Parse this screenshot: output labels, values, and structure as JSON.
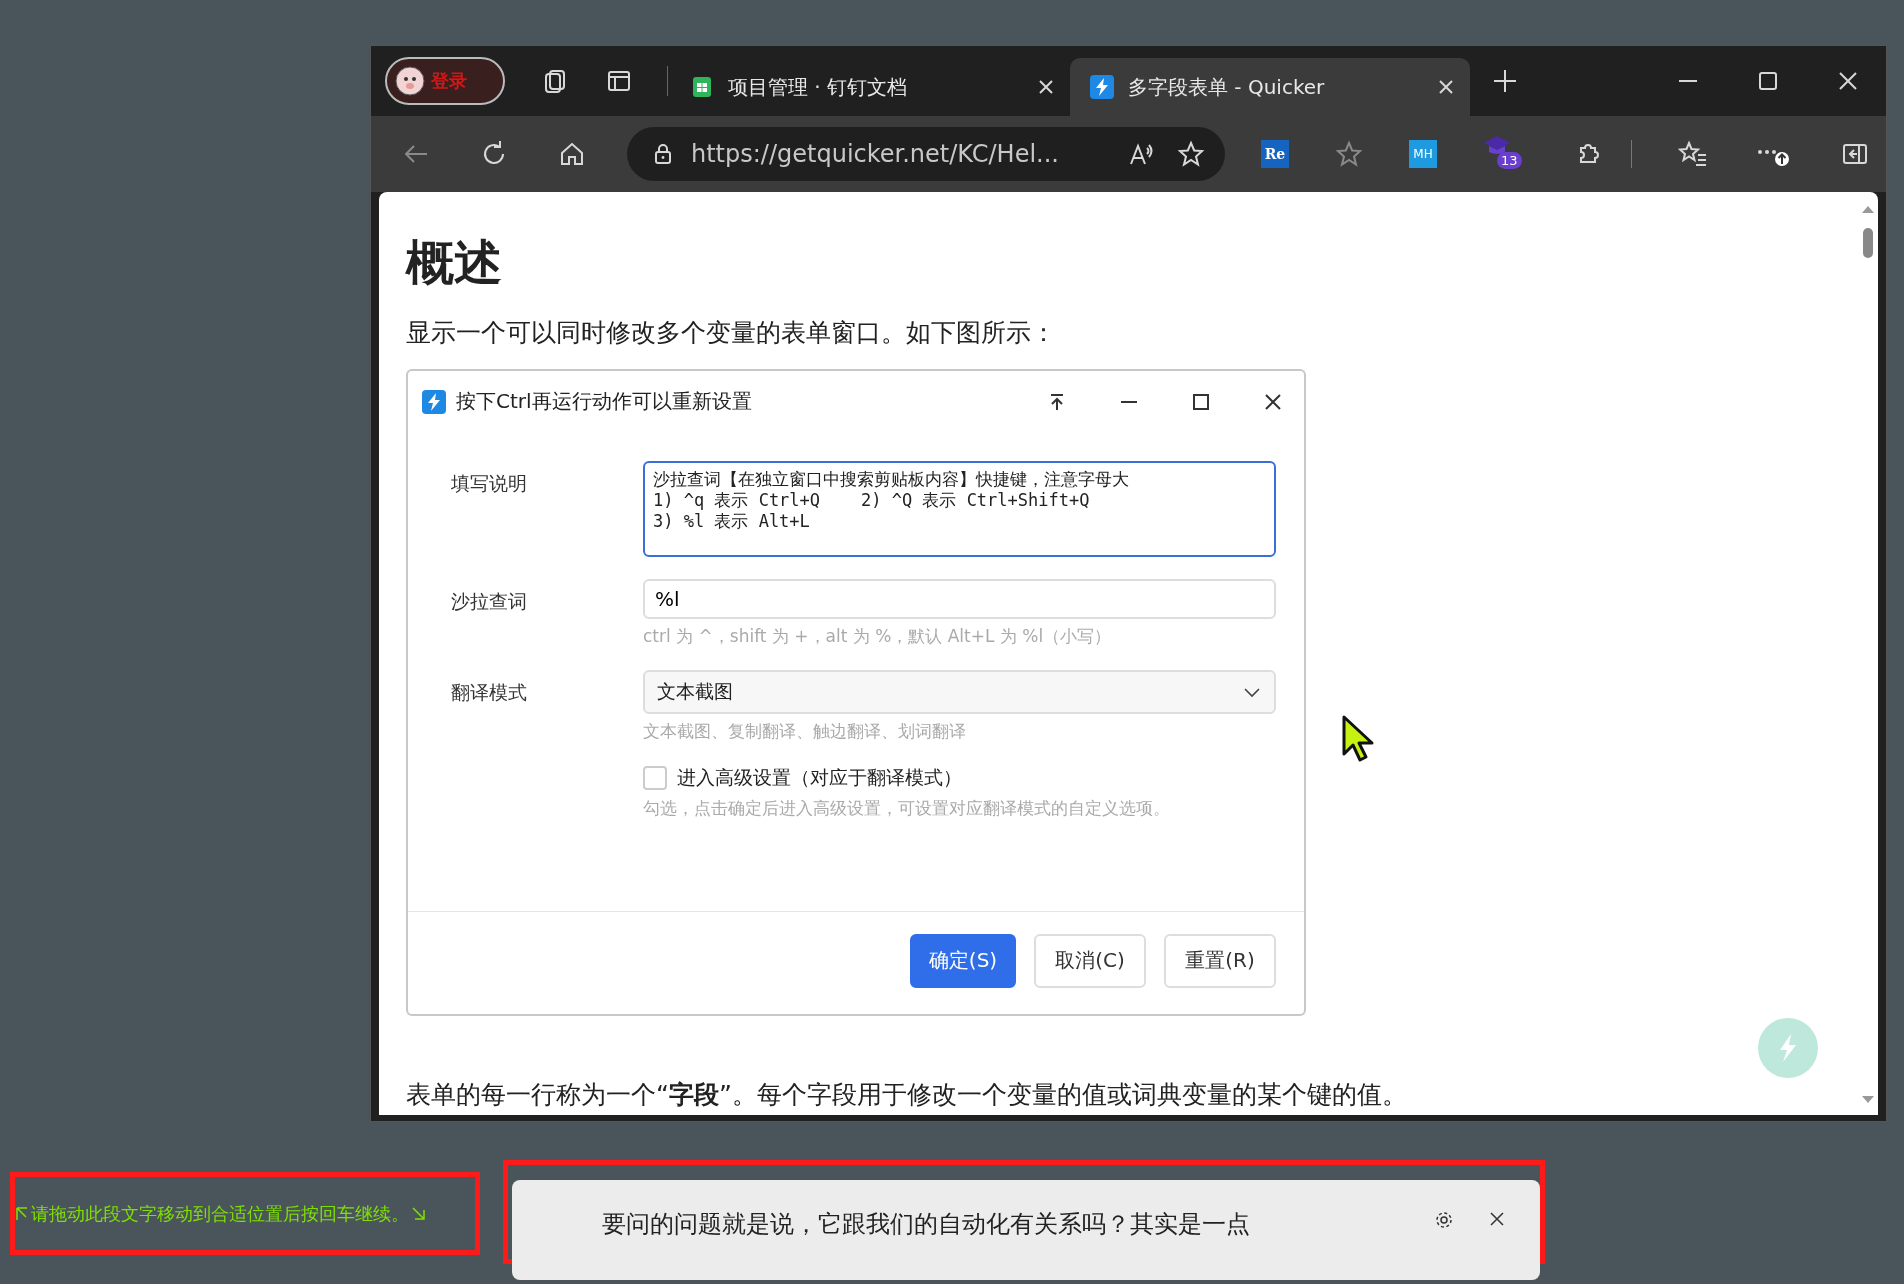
{
  "browser": {
    "profile_label": "登录",
    "tabs": [
      {
        "title": "项目管理 · 钉钉文档",
        "selected": false,
        "kind": "sheet"
      },
      {
        "title": "多字段表单 - Quicker",
        "selected": true,
        "kind": "quicker"
      }
    ],
    "address": "https://getquicker.net/KC/Hel...",
    "extension_badge": "13",
    "extension_labels": [
      "Re",
      "MH"
    ]
  },
  "page": {
    "heading": "概述",
    "intro": "显示一个可以同时修改多个变量的表单窗口。如下图所示：",
    "dialog": {
      "title": "按下Ctrl再运行动作可以重新设置",
      "fields": [
        {
          "kind": "textarea",
          "label": "填写说明",
          "lines": [
            "沙拉查词【在独立窗口中搜索剪贴板内容】快捷键，注意字母大",
            "1) ^q 表示 Ctrl+Q    2) ^Q 表示 Ctrl+Shift+Q",
            "3) %l 表示 Alt+L"
          ]
        },
        {
          "kind": "input",
          "label": "沙拉查词",
          "value": "%l",
          "hint": "ctrl 为 ^，shift 为 +，alt 为 %，默认 Alt+L 为 %l（小写）"
        },
        {
          "kind": "select",
          "label": "翻译模式",
          "value": "文本截图",
          "hint": "文本截图、复制翻译、触边翻译、划词翻译"
        },
        {
          "kind": "checkbox",
          "text": "进入高级设置（对应于翻译模式）",
          "checked": false,
          "hint": "勾选，点击确定后进入高级设置，可设置对应翻译模式的自定义选项。"
        }
      ],
      "buttons": [
        {
          "label": "确定(S)",
          "primary": true
        },
        {
          "label": "取消(C)",
          "primary": false
        },
        {
          "label": "重置(R)",
          "primary": false
        }
      ]
    },
    "body_text": "表单的每一行称为一个“**字段**”。每个字段用于修改一个变量的值或词典变量的某个键的值。"
  },
  "drag_hint": "请拖动此段文字移动到合适位置后按回车继续。",
  "notification": {
    "text": "要问的问题就是说，它跟我们的自动化有关系吗？其实是一点"
  }
}
